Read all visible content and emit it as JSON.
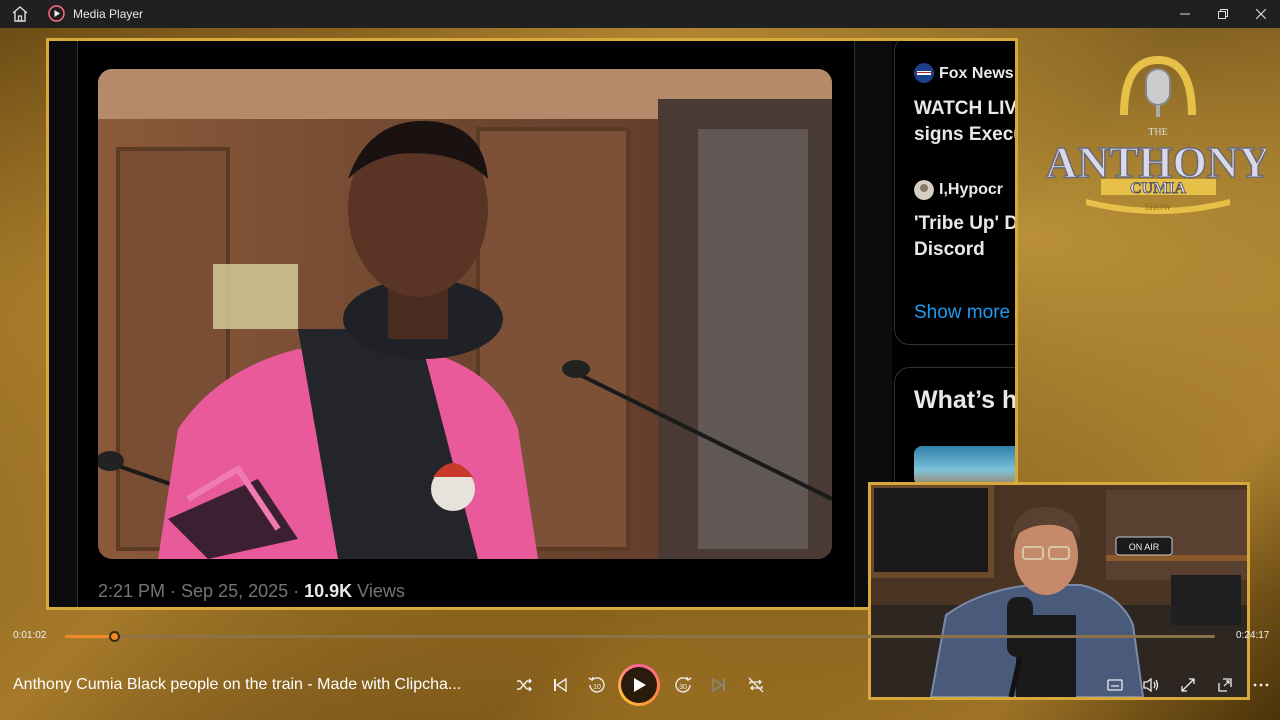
{
  "window": {
    "title": "Media Player"
  },
  "tweet": {
    "time": "2:21 PM · Sep 25, 2025 · ",
    "views_count": "10.9K",
    "views_label": " Views"
  },
  "sidebar": {
    "trends": [
      {
        "source": "Fox News",
        "text_line1": "WATCH LIV",
        "text_line2": "signs Execu"
      },
      {
        "source": "I,Hypocr",
        "text_line1": "'Tribe Up' D",
        "text_line2": "Discord"
      }
    ],
    "show_more": "Show more",
    "whats_heading": "What’s h"
  },
  "logo": {
    "the": "THE",
    "name_line1": "ANTHONY",
    "name_line2": "CUMIA",
    "show": "SHOW"
  },
  "cam": {
    "on_air": "ON AIR"
  },
  "player": {
    "elapsed": "0:01:02",
    "duration": "0:24:17",
    "progress": 0.043,
    "media_title": "Anthony Cumia Black people on the train - Made with Clipcha...",
    "rewind_seconds": "10",
    "forward_seconds": "30"
  },
  "colors": {
    "accent": "#f08a28",
    "frame_gold": "#d7a93d",
    "link_blue": "#1d9bf0"
  }
}
